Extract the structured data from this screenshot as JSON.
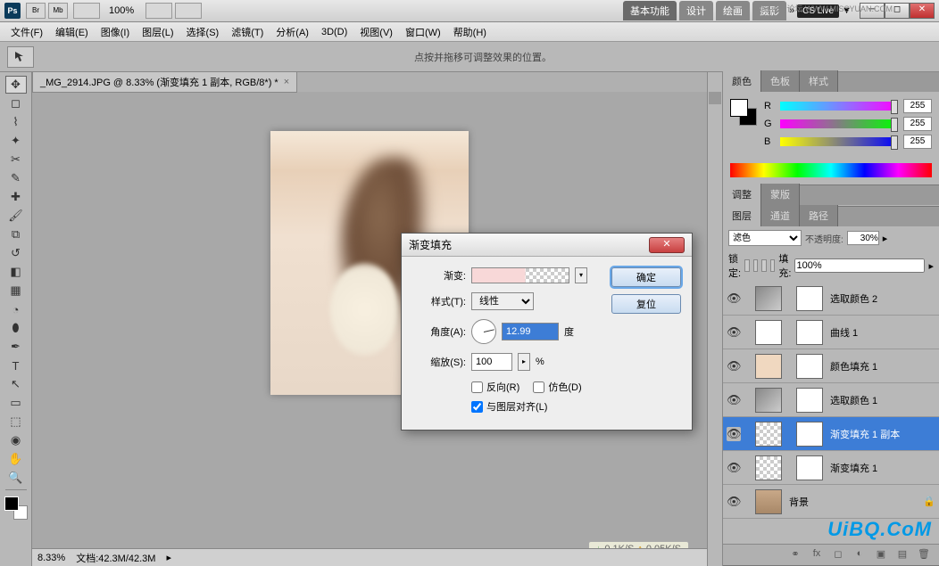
{
  "titlebar": {
    "zoom": "100%",
    "tabs": [
      "基本功能",
      "设计",
      "绘画",
      "摄影"
    ],
    "cslive": "CS Live",
    "watermark_top": "思缘设计论坛  WWW.MISSYUAN.COM"
  },
  "menu": [
    "文件(F)",
    "编辑(E)",
    "图像(I)",
    "图层(L)",
    "选择(S)",
    "滤镜(T)",
    "分析(A)",
    "3D(D)",
    "视图(V)",
    "窗口(W)",
    "帮助(H)"
  ],
  "options_hint": "点按并拖移可调整效果的位置。",
  "doc_tab": "_MG_2914.JPG @ 8.33% (渐变填充 1 副本, RGB/8*) *",
  "netspeed": {
    "down": "0.1K/S",
    "up": "0.05K/S"
  },
  "status": {
    "zoom": "8.33%",
    "docsize": "文档:42.3M/42.3M"
  },
  "color_panel": {
    "tabs": [
      "颜色",
      "色板",
      "样式"
    ],
    "r": "255",
    "g": "255",
    "b": "255"
  },
  "adjust_tabs": [
    "调整",
    "蒙版"
  ],
  "layers_panel": {
    "tabs": [
      "图层",
      "通道",
      "路径"
    ],
    "blend": "滤色",
    "opacity_label": "不透明度:",
    "opacity": "30%",
    "lock_label": "锁定:",
    "fill_label": "填充:",
    "fill": "100%",
    "layers": [
      {
        "name": "选取颜色 2",
        "thumb": "adj",
        "sel": false
      },
      {
        "name": "曲线 1",
        "thumb": "curve",
        "sel": false
      },
      {
        "name": "颜色填充 1",
        "thumb": "fill",
        "sel": false
      },
      {
        "name": "选取颜色 1",
        "thumb": "adj",
        "sel": false
      },
      {
        "name": "渐变填充 1 副本",
        "thumb": "grad",
        "sel": true
      },
      {
        "name": "渐变填充 1",
        "thumb": "grad",
        "sel": false
      },
      {
        "name": "背景",
        "thumb": "img",
        "sel": false,
        "locked": true,
        "nomask": true
      }
    ]
  },
  "dialog": {
    "title": "渐变填充",
    "gradient_label": "渐变:",
    "style_label": "样式(T):",
    "style_value": "线性",
    "angle_label": "角度(A):",
    "angle_value": "12.99",
    "angle_unit": "度",
    "scale_label": "缩放(S):",
    "scale_value": "100",
    "scale_unit": "%",
    "reverse": "反向(R)",
    "dither": "仿色(D)",
    "align": "与图层对齐(L)",
    "ok": "确定",
    "reset": "复位"
  },
  "watermark": "UiBQ.CoM"
}
